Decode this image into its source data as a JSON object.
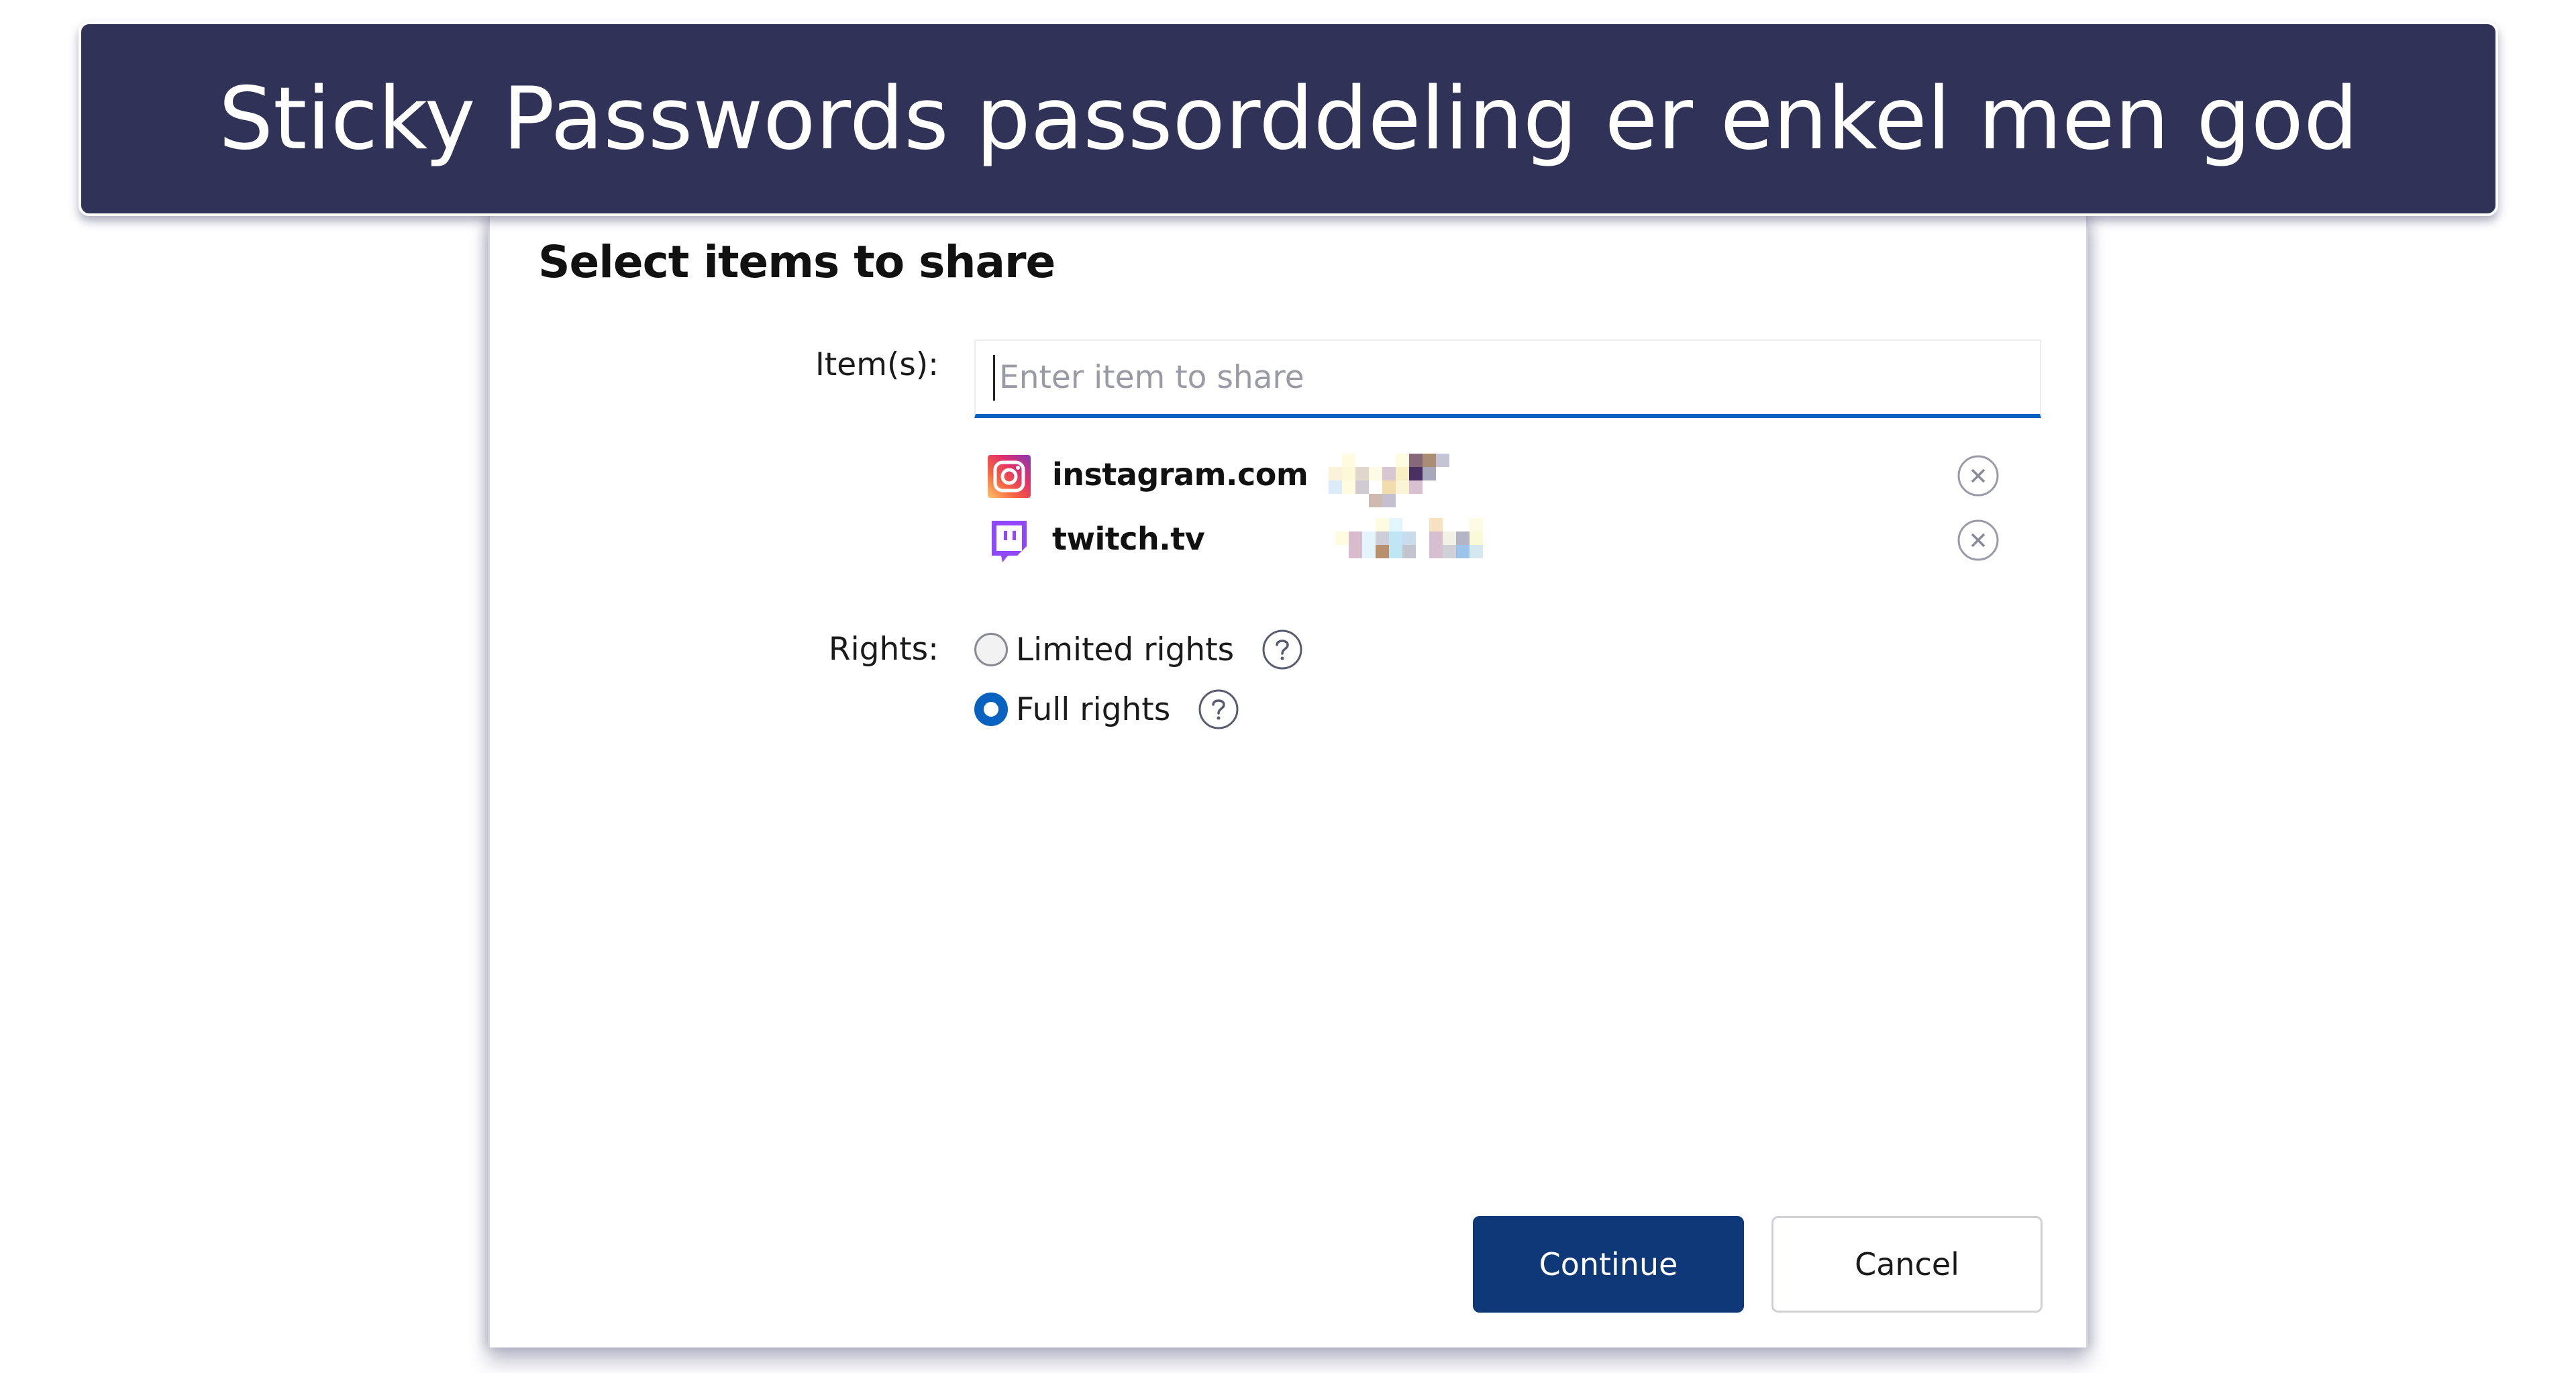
{
  "banner": {
    "title": "Sticky Passwords passorddeling er enkel men god",
    "background_color": "#313257"
  },
  "dialog": {
    "title": "Select items to share",
    "items_field": {
      "label": "Item(s):",
      "value": "",
      "placeholder": "Enter item to share"
    },
    "selected_items": [
      {
        "icon": "instagram-icon",
        "name": "instagram.com",
        "username": "[pixelated]",
        "remove_icon": "close-circle-icon"
      },
      {
        "icon": "twitch-icon",
        "name": "twitch.tv",
        "username": "[pixelated]",
        "remove_icon": "close-circle-icon"
      }
    ],
    "rights": {
      "label": "Rights:",
      "options": [
        {
          "label": "Limited rights",
          "selected": false,
          "help_icon": "question-circle-icon"
        },
        {
          "label": "Full rights",
          "selected": true,
          "help_icon": "question-circle-icon"
        }
      ]
    },
    "buttons": {
      "continue_label": "Continue",
      "cancel_label": "Cancel"
    },
    "accent_color": "#0a62c0",
    "primary_button_color": "#0e3878"
  }
}
